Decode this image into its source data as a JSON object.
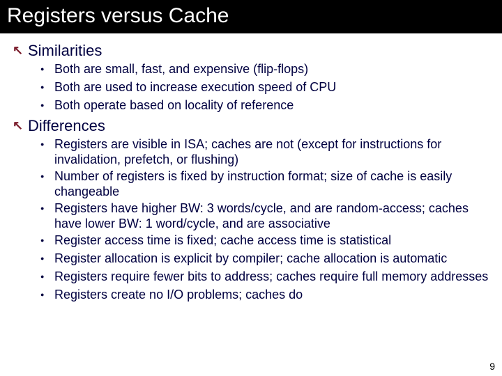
{
  "title": "Registers versus Cache",
  "sections": [
    {
      "heading": "Similarities",
      "items": [
        "Both are small, fast, and expensive (flip-flops)",
        "Both are used to increase execution speed of CPU",
        "Both operate based on locality of reference"
      ]
    },
    {
      "heading": "Differences",
      "items": [
        "Registers are visible in ISA; caches are not (except for instructions for invalidation, prefetch, or flushing)",
        "Number of registers is fixed by instruction format; size of cache is easily changeable",
        "Registers have higher BW: 3 words/cycle, and are random-access; caches have lower BW: 1 word/cycle, and are associative",
        "Register access time is fixed; cache access time is statistical",
        "Register allocation is explicit by compiler; cache allocation is automatic",
        "Registers require fewer bits to address; caches require full memory addresses",
        "Registers create no I/O problems; caches do"
      ]
    }
  ],
  "page_number": "9"
}
